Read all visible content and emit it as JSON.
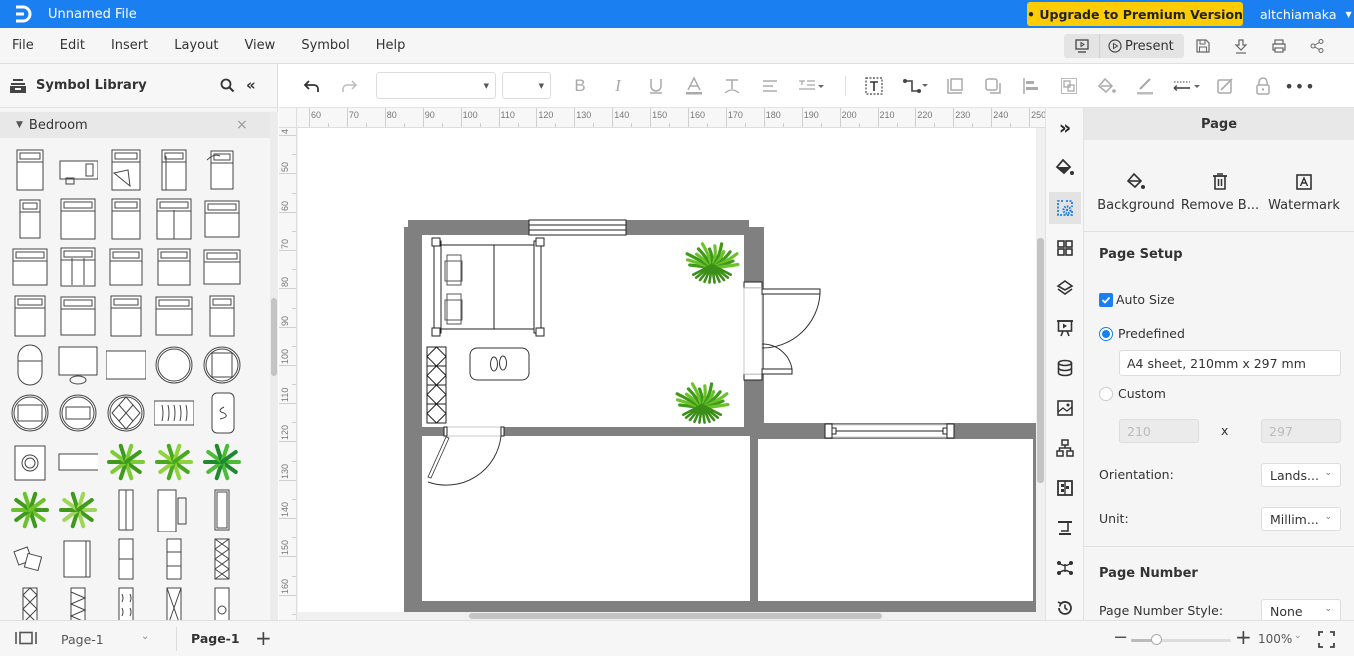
{
  "titlebar": {
    "file_name": "Unnamed File",
    "upgrade_label": "• Upgrade to Premium Version",
    "username": "altchiamaka",
    "accent_color": "#1a7ff0",
    "upgrade_color": "#ffcc00"
  },
  "menubar": {
    "items": [
      "File",
      "Edit",
      "Insert",
      "Layout",
      "View",
      "Symbol",
      "Help"
    ],
    "present_label": "Present",
    "right_icons": [
      "presentation-icon",
      "save-icon",
      "download-icon",
      "print-icon",
      "share-icon"
    ]
  },
  "toolbar": {
    "font_family_value": "",
    "font_size_value": "",
    "icons": [
      "undo-icon",
      "redo-icon",
      "bold-icon",
      "italic-icon",
      "underline-icon",
      "font-color-icon",
      "text-format-icon",
      "align-icon",
      "line-spacing-icon",
      "text-box-icon",
      "connector-icon",
      "bring-front-icon",
      "send-back-icon",
      "align-left-icon",
      "group-icon",
      "fill-icon",
      "line-color-icon",
      "line-style-icon",
      "style-icon",
      "lock-icon",
      "more-icon"
    ]
  },
  "symbol_library": {
    "title": "Symbol Library",
    "category": "Bedroom",
    "symbol_count": 45
  },
  "rulers": {
    "horizontal": [
      "60",
      "70",
      "80",
      "90",
      "100",
      "110",
      "120",
      "130",
      "140",
      "150",
      "160",
      "170",
      "180",
      "190",
      "200",
      "210",
      "220",
      "230",
      "240",
      "250"
    ],
    "vertical": [
      "4",
      "50",
      "60",
      "70",
      "80",
      "90",
      "100",
      "110",
      "120",
      "130",
      "140",
      "150",
      "160",
      "70"
    ]
  },
  "right_rail": {
    "icons": [
      "expand-icon",
      "fill-icon",
      "page-settings-icon",
      "grid-icon",
      "layers-icon",
      "presentation-icon",
      "data-icon",
      "image-icon",
      "org-chart-icon",
      "widget-icon",
      "connector-icon",
      "mind-map-icon",
      "history-icon"
    ]
  },
  "page_panel": {
    "title": "Page",
    "actions": [
      {
        "label": "Background",
        "icon": "paint-bucket-icon"
      },
      {
        "label": "Remove B...",
        "icon": "trash-icon"
      },
      {
        "label": "Watermark",
        "icon": "watermark-icon"
      }
    ],
    "page_setup_title": "Page Setup",
    "auto_size_label": "Auto Size",
    "auto_size_checked": true,
    "predefined_label": "Predefined",
    "predefined_selected": true,
    "predefined_value": "A4 sheet, 210mm x 297 mm",
    "custom_label": "Custom",
    "custom_width": "210",
    "custom_x": "x",
    "custom_height": "297",
    "orientation_label": "Orientation:",
    "orientation_value": "Lands...",
    "unit_label": "Unit:",
    "unit_value": "Millim...",
    "page_number_title": "Page Number",
    "page_number_style_label": "Page Number Style:",
    "page_number_style_value": "None"
  },
  "statusbar": {
    "page_selector": "Page-1",
    "active_tab": "Page-1",
    "add_label": "+",
    "zoom_value": "100%",
    "zoom_fraction": 0.25
  }
}
